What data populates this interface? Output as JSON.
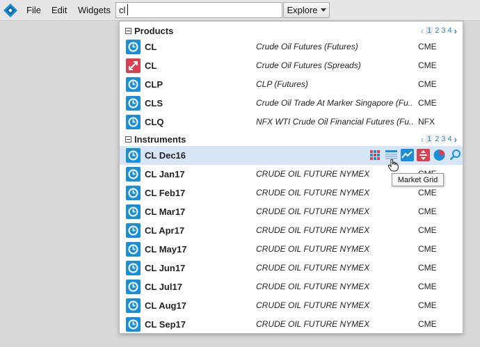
{
  "menu": {
    "file": "File",
    "edit": "Edit",
    "widgets": "Widgets"
  },
  "search": {
    "value": "cl",
    "placeholder": ""
  },
  "explore": {
    "label": "Explore"
  },
  "products": {
    "title": "Products",
    "pages": [
      "1",
      "2",
      "3",
      "4"
    ],
    "current_page": "1",
    "rows": [
      {
        "symbol": "CL",
        "description": "Crude Oil Futures (Futures)",
        "exchange": "CME",
        "icon": "futures-icon"
      },
      {
        "symbol": "CL",
        "description": "Crude Oil Futures (Spreads)",
        "exchange": "CME",
        "icon": "spread-icon"
      },
      {
        "symbol": "CLP",
        "description": "CLP (Futures)",
        "exchange": "CME",
        "icon": "futures-icon"
      },
      {
        "symbol": "CLS",
        "description": "Crude Oil Trade At Marker Singapore (Fu...",
        "exchange": "CME",
        "icon": "futures-icon"
      },
      {
        "symbol": "CLQ",
        "description": "NFX WTI Crude Oil Financial Futures (Fu...",
        "exchange": "NFX",
        "icon": "futures-icon"
      }
    ]
  },
  "instruments": {
    "title": "Instruments",
    "pages": [
      "1",
      "2",
      "3",
      "4"
    ],
    "current_page": "1",
    "selected": {
      "symbol": "CL Dec16",
      "icon": "futures-icon"
    },
    "rows": [
      {
        "symbol": "CL Jan17",
        "description": "CRUDE OIL FUTURE NYMEX",
        "exchange": "CME"
      },
      {
        "symbol": "CL Feb17",
        "description": "CRUDE OIL FUTURE NYMEX",
        "exchange": "CME"
      },
      {
        "symbol": "CL Mar17",
        "description": "CRUDE OIL FUTURE NYMEX",
        "exchange": "CME"
      },
      {
        "symbol": "CL Apr17",
        "description": "CRUDE OIL FUTURE NYMEX",
        "exchange": "CME"
      },
      {
        "symbol": "CL May17",
        "description": "CRUDE OIL FUTURE NYMEX",
        "exchange": "CME"
      },
      {
        "symbol": "CL Jun17",
        "description": "CRUDE OIL FUTURE NYMEX",
        "exchange": "CME"
      },
      {
        "symbol": "CL Jul17",
        "description": "CRUDE OIL FUTURE NYMEX",
        "exchange": "CME"
      },
      {
        "symbol": "CL Aug17",
        "description": "CRUDE OIL FUTURE NYMEX",
        "exchange": "CME"
      },
      {
        "symbol": "CL Sep17",
        "description": "CRUDE OIL FUTURE NYMEX",
        "exchange": "CME"
      }
    ]
  },
  "row_actions": [
    "price-ladder-icon",
    "market-grid-icon",
    "chart-icon",
    "spread-matrix-icon",
    "pie-chart-icon",
    "search-icon"
  ],
  "tooltip": {
    "text": "Market Grid"
  },
  "colors": {
    "futures_icon": "#1a8fd6",
    "spread_icon": "#d8414f",
    "selected_row": "#d6e6f7",
    "link": "#2a7ccc"
  }
}
